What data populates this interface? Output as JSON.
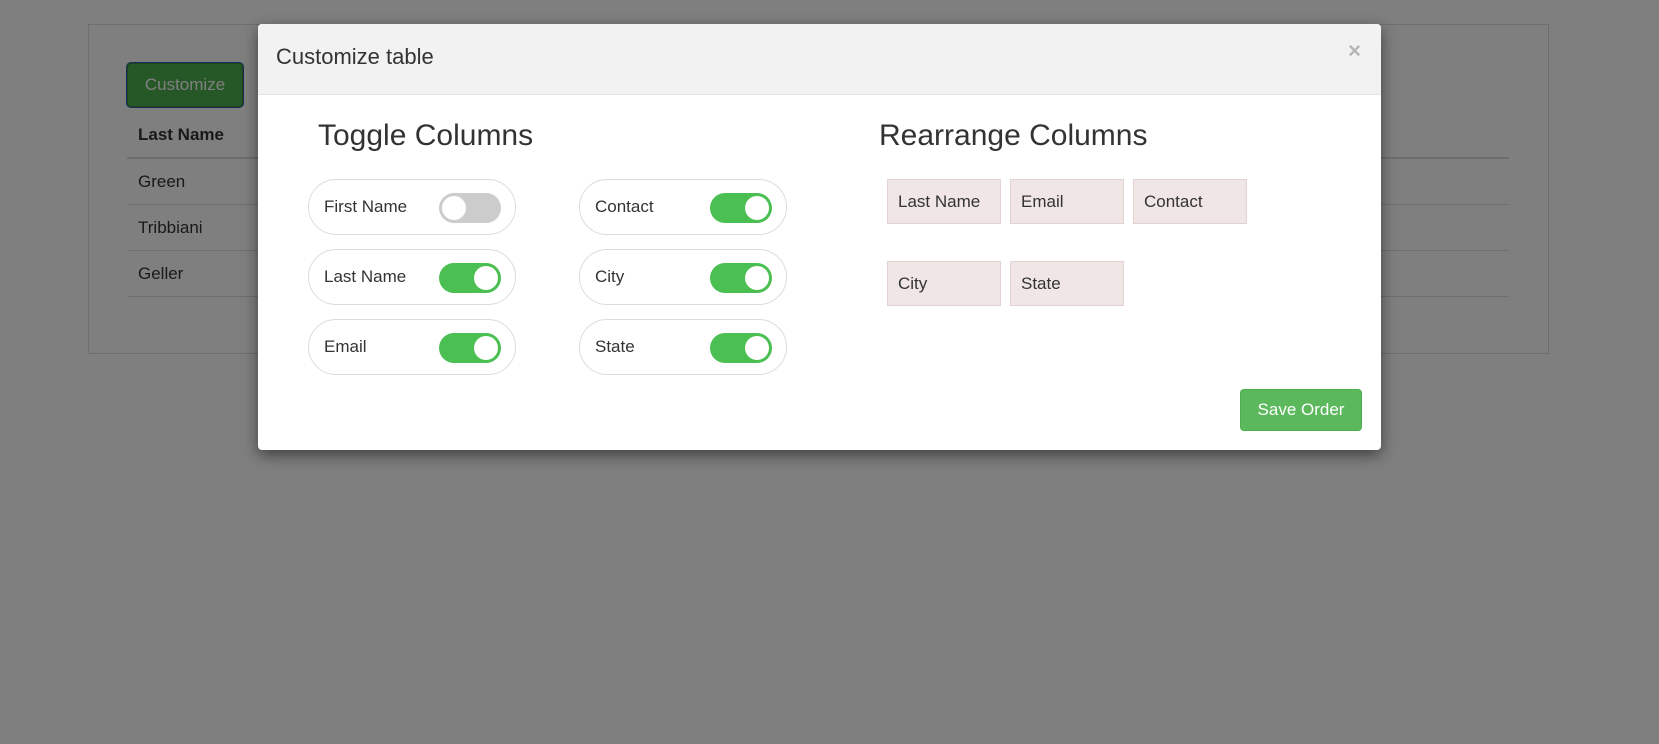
{
  "background": {
    "customize_label": "Customize",
    "table": {
      "header": "Last Name",
      "rows": [
        "Green",
        "Tribbiani",
        "Geller"
      ]
    }
  },
  "modal": {
    "title": "Customize table",
    "close_symbol": "×",
    "toggle": {
      "heading": "Toggle Columns",
      "items": [
        {
          "label": "First Name",
          "on": false
        },
        {
          "label": "Contact",
          "on": true
        },
        {
          "label": "Last Name",
          "on": true
        },
        {
          "label": "City",
          "on": true
        },
        {
          "label": "Email",
          "on": true
        },
        {
          "label": "State",
          "on": true
        }
      ]
    },
    "rearrange": {
      "heading": "Rearrange Columns",
      "columns": [
        "Last Name",
        "Email",
        "Contact",
        "City",
        "State"
      ]
    },
    "save_label": "Save Order"
  },
  "colors": {
    "accent": "#5cb85c",
    "switch_on": "#4bbf52",
    "switch_off": "#cccccc",
    "chip_bg": "#f0e6e6"
  }
}
